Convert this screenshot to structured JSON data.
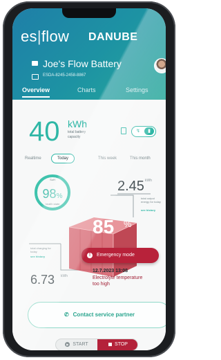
{
  "header": {
    "brand_left": "es",
    "brand_sep": "|",
    "brand_right": "flow",
    "product": "DANUBE",
    "battery_name": "Joe's Flow Battery",
    "serial": "ESDA-8245-2458-8867"
  },
  "tabs": [
    {
      "label": "Overview",
      "active": true
    },
    {
      "label": "Charts",
      "active": false
    },
    {
      "label": "Settings",
      "active": false
    }
  ],
  "capacity": {
    "value": "40",
    "unit": "kWh",
    "label": "total battery capacity"
  },
  "periods": [
    {
      "label": "Realtime",
      "active": false
    },
    {
      "label": "Today",
      "active": true
    },
    {
      "label": "This week",
      "active": false
    },
    {
      "label": "This month",
      "active": false
    }
  ],
  "health": {
    "top_label": "SoH",
    "value": "98",
    "unit": "%",
    "label": "health state"
  },
  "output": {
    "value": "2.45",
    "unit": "kWh",
    "label": "total output energy for today",
    "link": "see history"
  },
  "input": {
    "value": "6.73",
    "unit": "kWh",
    "label": "total charging for today",
    "link": "see history"
  },
  "soc": {
    "value": "85",
    "unit": "%"
  },
  "alert": {
    "button_label": "Emergency mode",
    "icon": "!",
    "time": "12.7.2023 13:08",
    "message": "Electrolyte temperature too high"
  },
  "contact": {
    "label": "Contact service partner",
    "icon": "phone-icon"
  },
  "controls": {
    "start_label": "START",
    "stop_label": "STOP"
  },
  "colors": {
    "accent": "#2fb7a6",
    "header": "#1f7fa8",
    "alert": "#b8223a"
  }
}
